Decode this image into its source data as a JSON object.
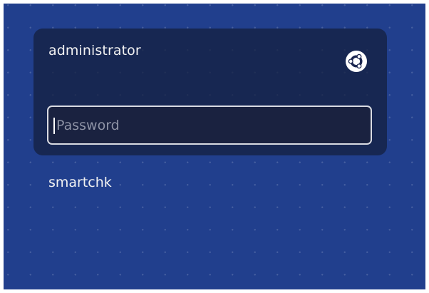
{
  "login": {
    "username": "administrator",
    "password_placeholder": "Password",
    "password_value": "",
    "session_icon": "ubuntu-logo-icon"
  },
  "other_users": [
    {
      "name": "smartchk"
    }
  ],
  "colors": {
    "background": "#213f8d",
    "card": "#1b2650",
    "field_border": "#d9dbe2",
    "text": "#f2f2f2"
  }
}
